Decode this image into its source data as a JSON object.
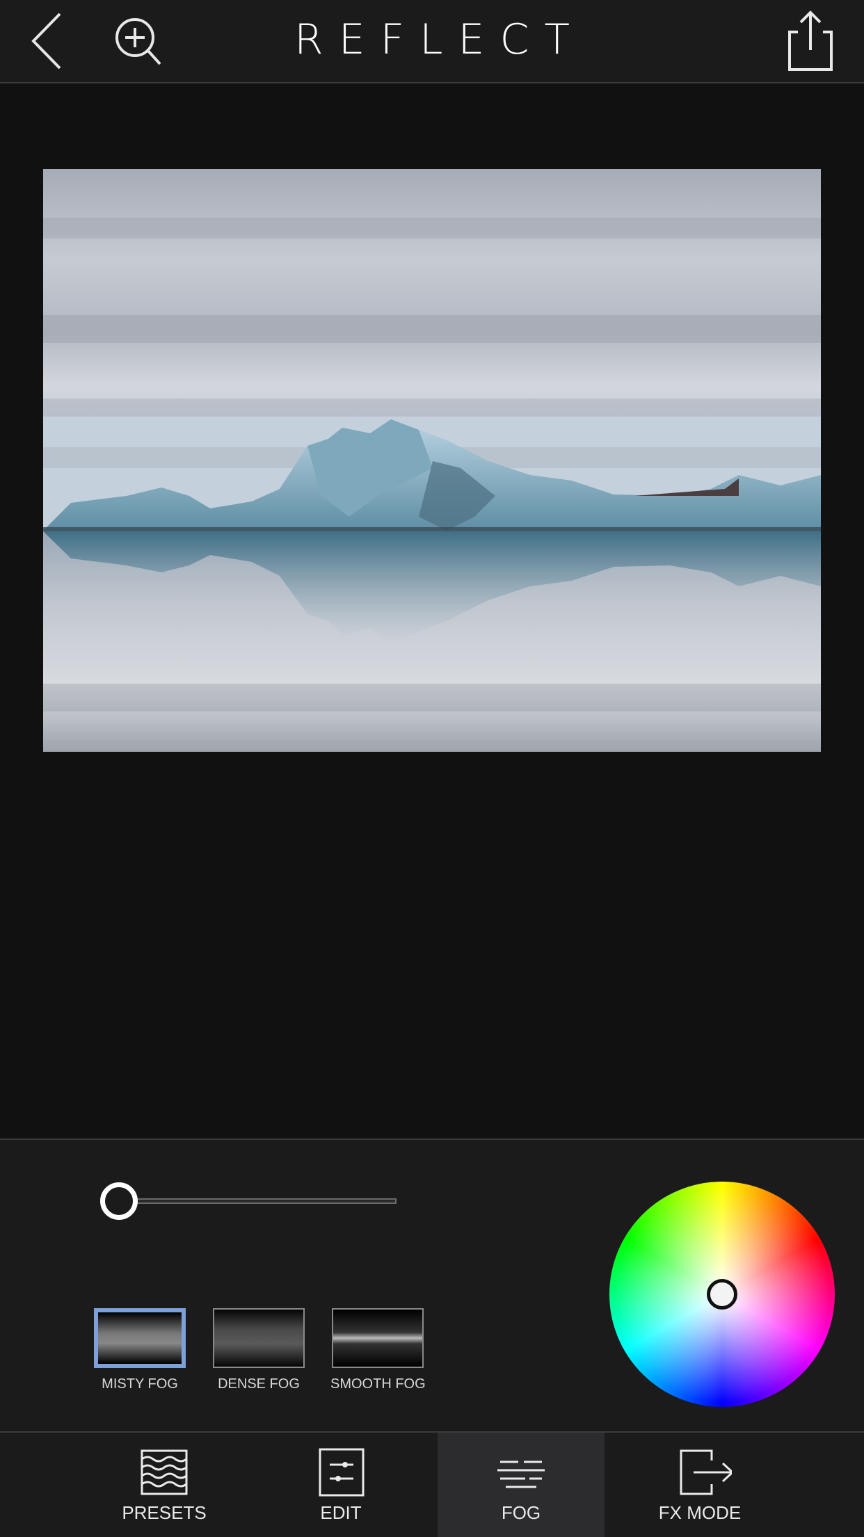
{
  "header": {
    "title": "REFLECT",
    "back_icon": "chevron-left-icon",
    "zoom_icon": "zoom-in-icon",
    "share_icon": "share-icon"
  },
  "photo": {
    "description_icon": "image"
  },
  "fog_controls": {
    "intensity_level": 0.0,
    "options": [
      {
        "label": "MISTY FOG",
        "selected": true
      },
      {
        "label": "DENSE FOG",
        "selected": false
      },
      {
        "label": "SMOOTH FOG",
        "selected": false
      }
    ],
    "selected_color": "#f3f3f3",
    "accent_color": "#7ea0d8"
  },
  "bottom_nav": {
    "tabs": [
      {
        "label": "PRESETS",
        "icon": "presets-icon",
        "active": false
      },
      {
        "label": "EDIT",
        "icon": "edit-sliders-icon",
        "active": false
      },
      {
        "label": "FOG",
        "icon": "fog-icon",
        "active": true
      },
      {
        "label": "FX MODE",
        "icon": "fx-mode-icon",
        "active": false
      }
    ]
  }
}
